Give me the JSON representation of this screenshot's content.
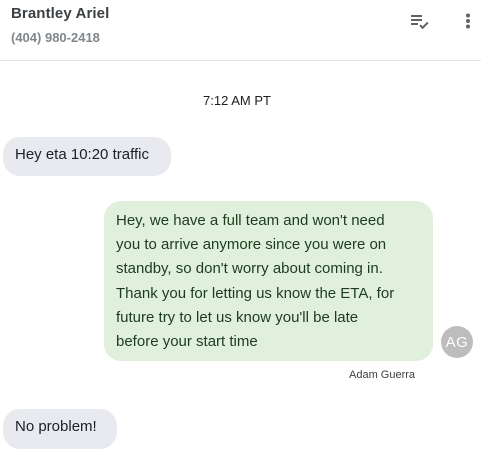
{
  "header": {
    "contact_name": "Brantley Ariel",
    "contact_phone": "(404) 980-2418",
    "icons": {
      "filter": "checklist-icon",
      "more": "more-vert-icon"
    }
  },
  "thread": {
    "timestamp": "7:12 AM PT",
    "messages": [
      {
        "direction": "incoming",
        "lines": [
          "Hey eta 10:20 traffic"
        ]
      },
      {
        "direction": "outgoing",
        "lines": [
          "Hey, we have a full team and won't need",
          "you to arrive anymore since you were on",
          "standby, so don't worry about coming in.",
          "Thank you for letting us know the ETA, for",
          "future try to let us know you'll be late",
          "before your start time"
        ],
        "avatar_initials": "AG",
        "sender": "Adam Guerra"
      },
      {
        "direction": "incoming",
        "lines": [
          "No problem!"
        ]
      }
    ]
  },
  "colors": {
    "incoming_bubble": "#e8eaf0",
    "outgoing_bubble": "#e1f0dc",
    "avatar_bg": "#bdbdbd",
    "icon": "#5f6368"
  }
}
